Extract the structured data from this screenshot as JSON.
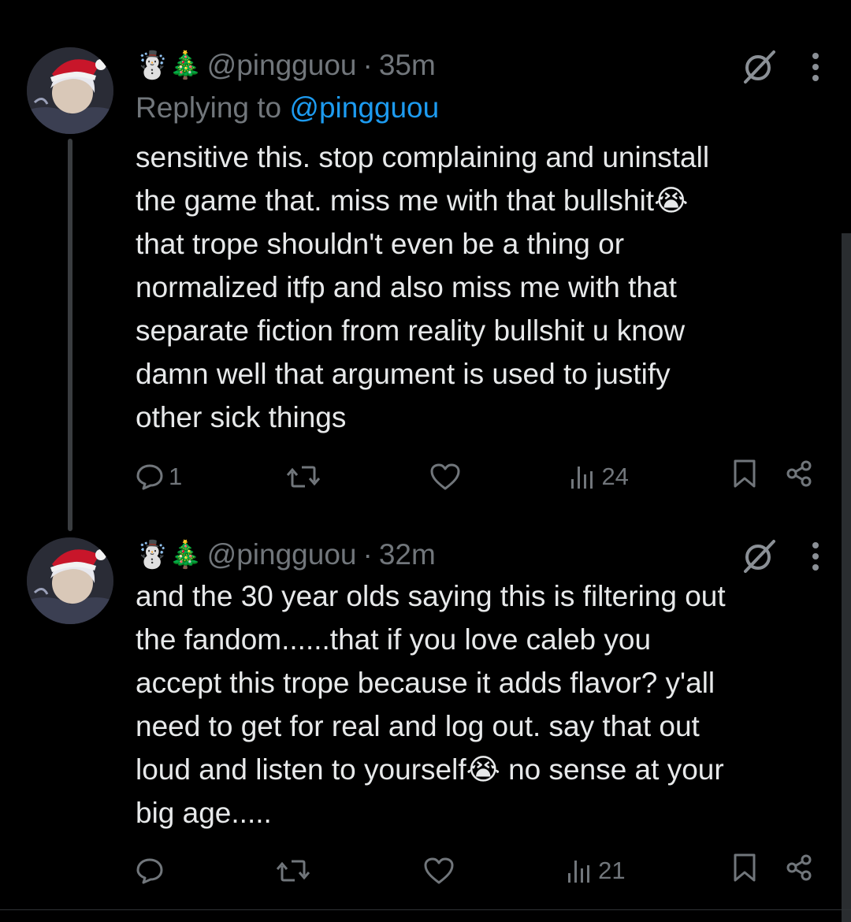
{
  "tweets": [
    {
      "emojis": "☃️🎄",
      "handle": "@pingguou",
      "time": "35m",
      "replying_prefix": "Replying to ",
      "replying_to": "@pingguou",
      "text": "sensitive this. stop complaining and uninstall\nthe game that. miss me with that bullshit😭\nthat trope shouldn't even be a thing or\nnormalized itfp and also miss me with that\nseparate fiction from reality bullshit u know\ndamn well that argument is used to justify\nother sick things",
      "replies": "1",
      "reposts": "",
      "likes": "",
      "views": "24"
    },
    {
      "emojis": "☃️🎄",
      "handle": "@pingguou",
      "time": "32m",
      "text": "and the 30 year olds saying this is filtering out\nthe fandom......that if you love caleb you\naccept this trope because it adds flavor? y'all\nneed to get for real and log out. say that out\nloud and listen to yourself😭 no sense at your\nbig age.....",
      "replies": "",
      "reposts": "",
      "likes": "",
      "views": "21"
    }
  ],
  "colors": {
    "background": "#000000",
    "text": "#e7e9ea",
    "muted": "#71767b",
    "link": "#1d9bf0"
  },
  "icons": [
    "grok-icon",
    "more-icon",
    "reply-icon",
    "repost-icon",
    "like-icon",
    "views-icon",
    "bookmark-icon",
    "share-icon"
  ]
}
